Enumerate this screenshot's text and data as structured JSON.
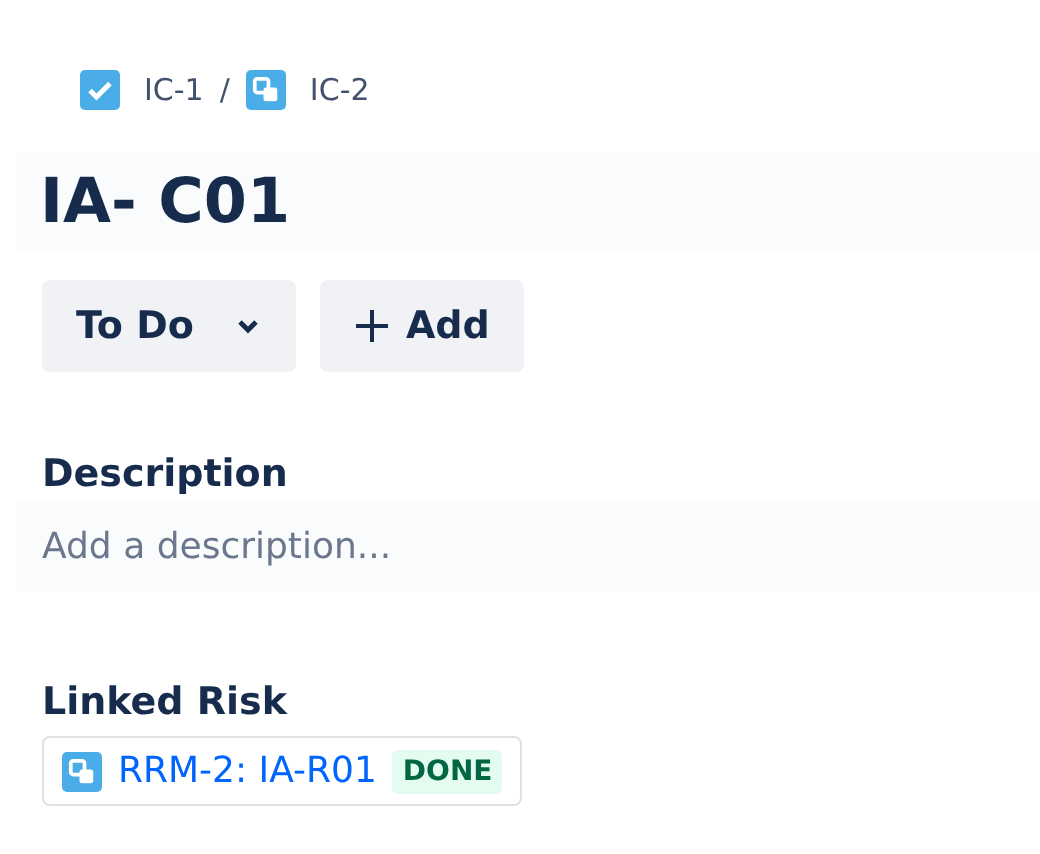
{
  "breadcrumbs": [
    {
      "label": "IC-1",
      "kind": "task"
    },
    {
      "label": "IC-2",
      "kind": "subtask"
    }
  ],
  "separator": "/",
  "title": "IA- C01",
  "actions": [
    {
      "label": "To Do",
      "kind": "dropdown"
    },
    {
      "label": "Add",
      "kind": "add"
    }
  ],
  "description": {
    "heading": "Description",
    "placeholder": "Add a description..."
  },
  "linked": {
    "heading": "Linked Risk",
    "items": [
      {
        "label": "RRM-2: IA-R01",
        "kind": "subtask",
        "status": "DONE"
      }
    ]
  }
}
